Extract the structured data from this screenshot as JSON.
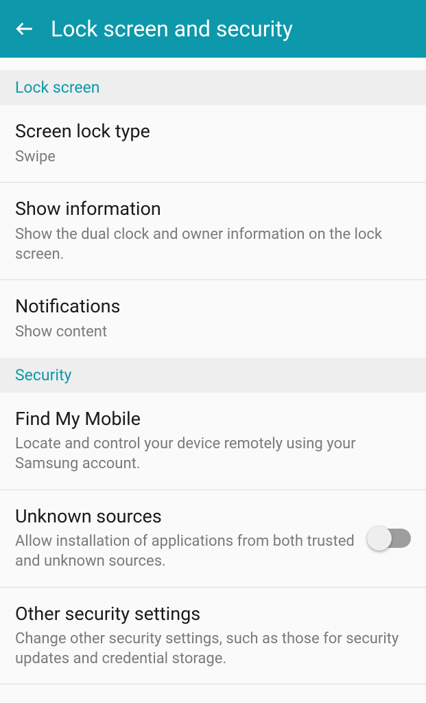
{
  "header": {
    "title": "Lock screen and security"
  },
  "sections": {
    "lock_screen": {
      "label": "Lock screen",
      "items": {
        "screen_lock_type": {
          "title": "Screen lock type",
          "subtitle": "Swipe"
        },
        "show_information": {
          "title": "Show information",
          "subtitle": "Show the dual clock and owner information on the lock screen."
        },
        "notifications": {
          "title": "Notifications",
          "subtitle": "Show content"
        }
      }
    },
    "security": {
      "label": "Security",
      "items": {
        "find_my_mobile": {
          "title": "Find My Mobile",
          "subtitle": "Locate and control your device remotely using your Samsung account."
        },
        "unknown_sources": {
          "title": "Unknown sources",
          "subtitle": "Allow installation of applications from both trusted and unknown sources.",
          "toggle": false
        },
        "other_security": {
          "title": "Other security settings",
          "subtitle": "Change other security settings, such as those for security updates and credential storage."
        }
      }
    }
  }
}
